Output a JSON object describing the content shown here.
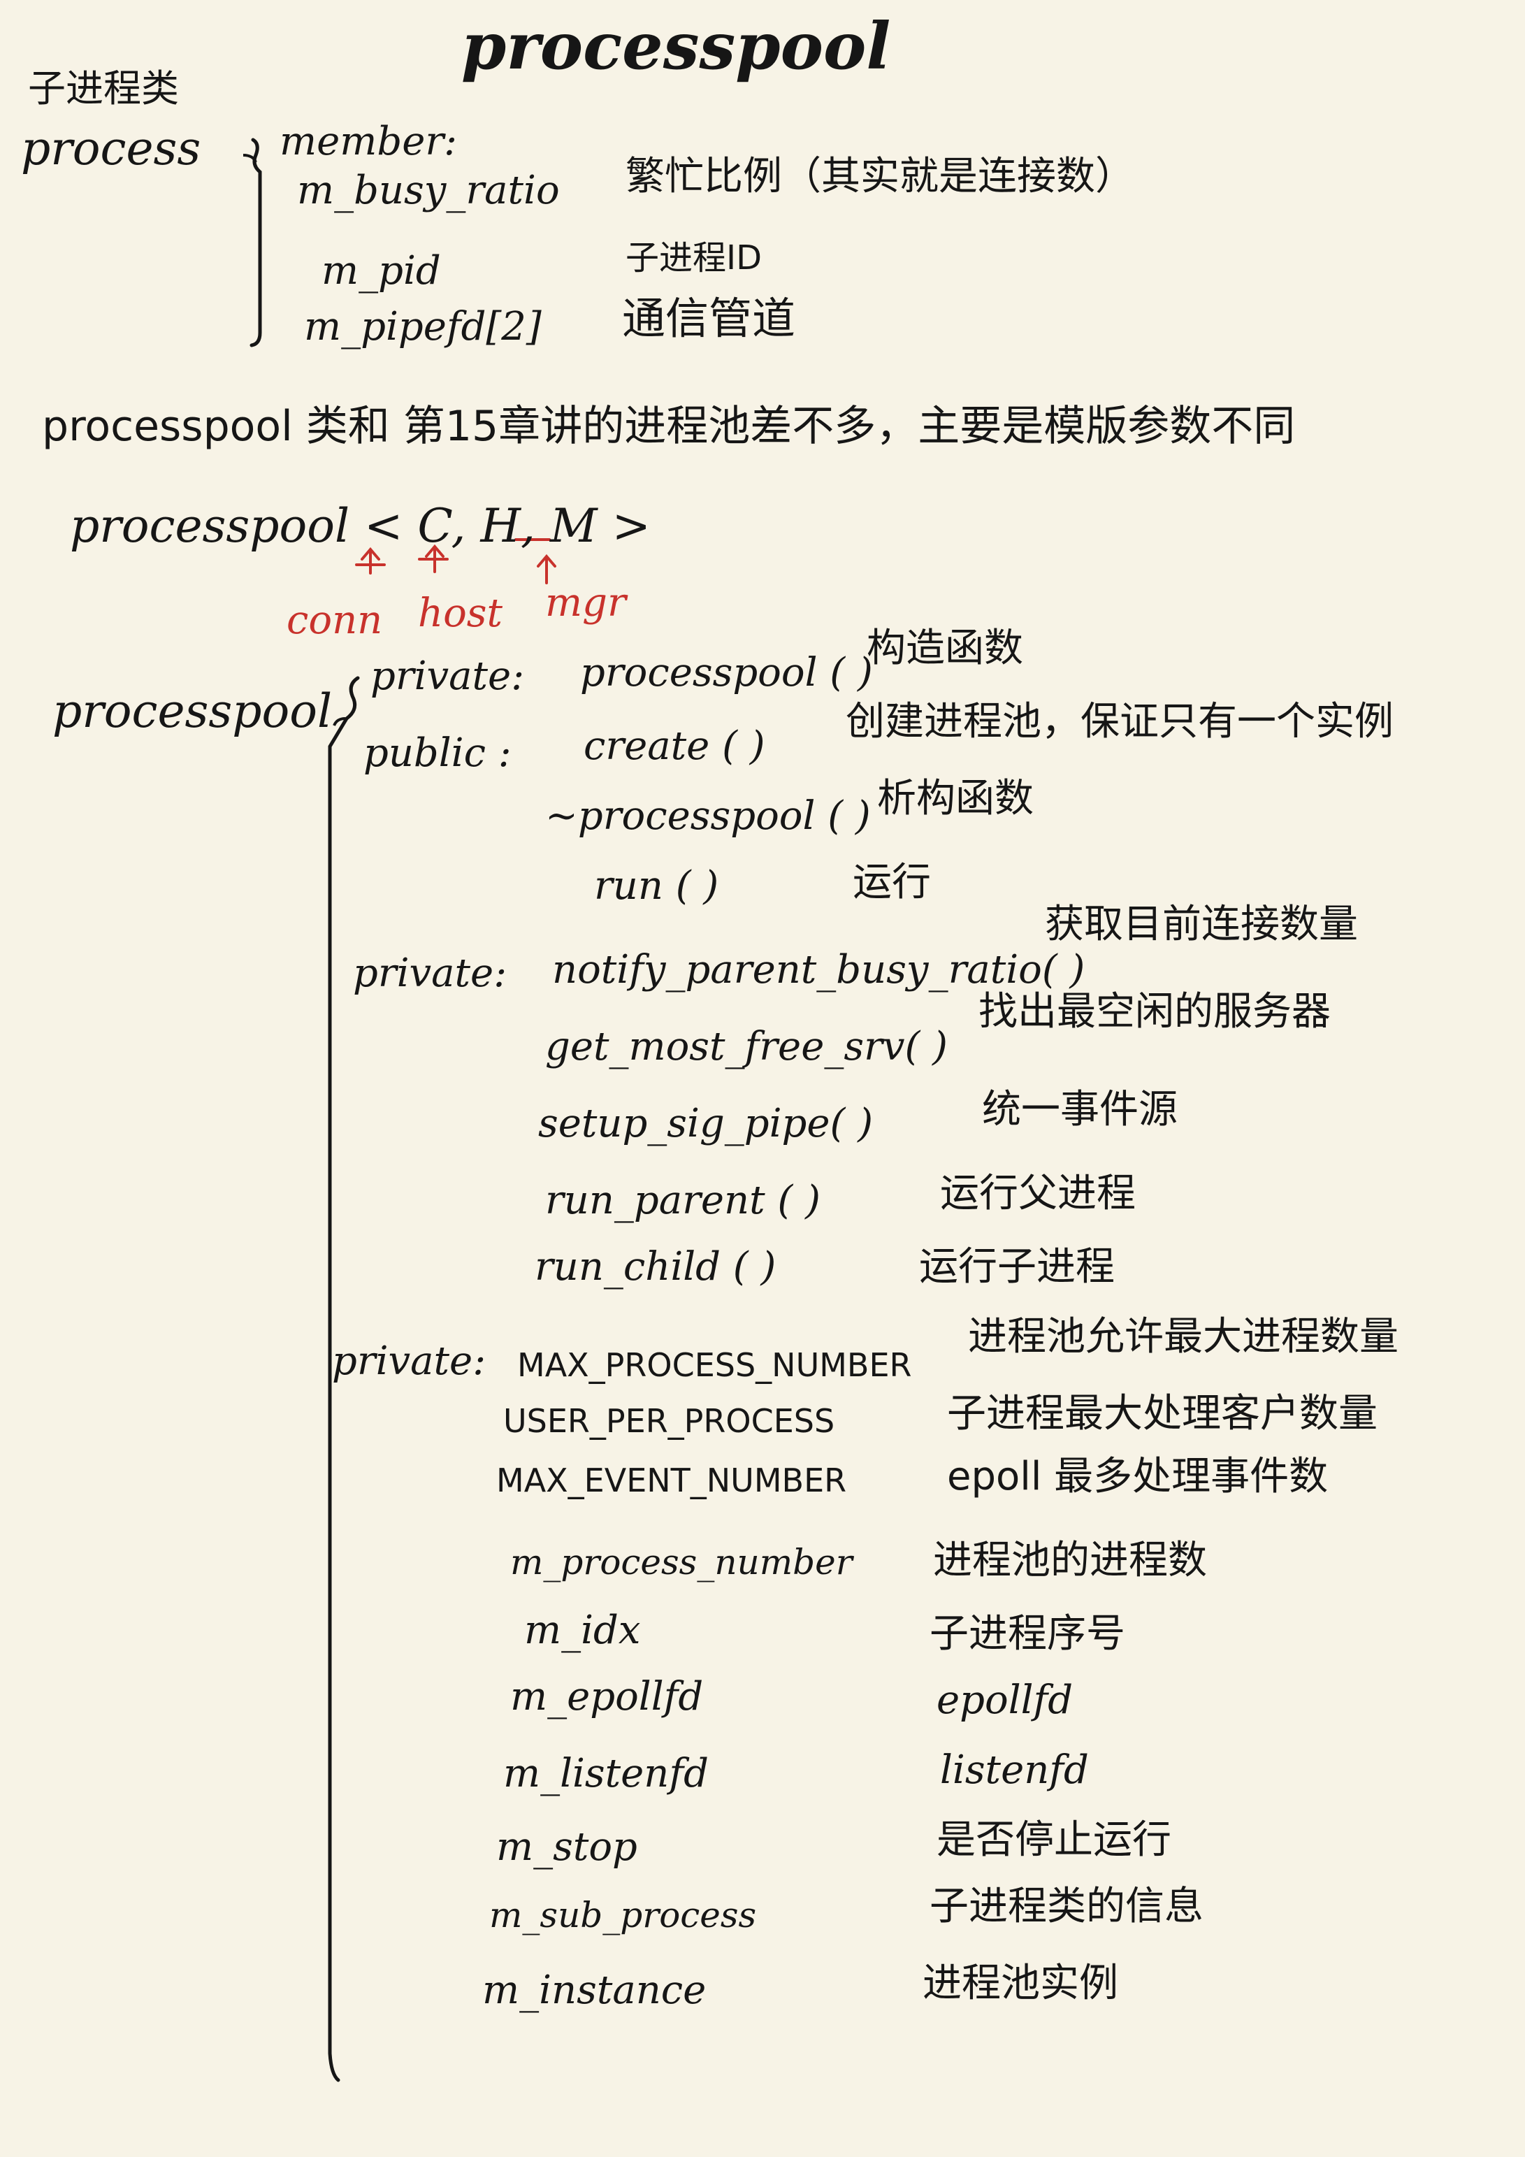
{
  "title": "processpool",
  "process_section": {
    "category_label": "子进程类",
    "class_name": "process",
    "member_label": "member:",
    "members": [
      {
        "name": "m_busy_ratio",
        "desc": "繁忙比例（其实就是连接数）"
      },
      {
        "name": "m_pid",
        "desc": "子进程ID"
      },
      {
        "name": "m_pipefd[2]",
        "desc": "通信管道"
      }
    ]
  },
  "note": {
    "sentence": "processpool 类和 第15章讲的进程池差不多，主要是模版参数不同",
    "template_decl": "processpool < C, H, M >",
    "annotations": [
      "conn",
      "host",
      "mgr"
    ]
  },
  "processpool_section": {
    "class_name": "processpool",
    "groups": [
      {
        "access": "private:",
        "items": [
          {
            "name": "processpool ( )",
            "desc": "构造函数"
          }
        ]
      },
      {
        "access": "public :",
        "items": [
          {
            "name": "create ( )",
            "desc": "创建进程池，保证只有一个实例"
          },
          {
            "name": "~processpool ( )",
            "desc": "析构函数"
          },
          {
            "name": "run ( )",
            "desc": "运行"
          }
        ]
      },
      {
        "access": "private:",
        "items": [
          {
            "name": "notify_parent_busy_ratio( )",
            "desc": "获取目前连接数量"
          },
          {
            "name": "get_most_free_srv( )",
            "desc": "找出最空闲的服务器"
          },
          {
            "name": "setup_sig_pipe( )",
            "desc": "统一事件源"
          },
          {
            "name": "run_parent ( )",
            "desc": "运行父进程"
          },
          {
            "name": "run_child ( )",
            "desc": "运行子进程"
          }
        ]
      },
      {
        "access": "private:",
        "items": [
          {
            "name": "MAX_PROCESS_NUMBER",
            "desc": "进程池允许最大进程数量"
          },
          {
            "name": "USER_PER_PROCESS",
            "desc": "子进程最大处理客户数量"
          },
          {
            "name": "MAX_EVENT_NUMBER",
            "desc": "epoll 最多处理事件数"
          },
          {
            "name": "m_process_number",
            "desc": "进程池的进程数"
          },
          {
            "name": "m_idx",
            "desc": "子进程序号"
          },
          {
            "name": "m_epollfd",
            "desc": "epollfd"
          },
          {
            "name": "m_listenfd",
            "desc": "listenfd"
          },
          {
            "name": "m_stop",
            "desc": "是否停止运行"
          },
          {
            "name": "m_sub_process",
            "desc": "子进程类的信息"
          },
          {
            "name": "m_instance",
            "desc": "进程池实例"
          }
        ]
      }
    ]
  },
  "colors": {
    "ink": "#161616",
    "annotation": "#c8322c",
    "paper": "#f7f3e6"
  }
}
